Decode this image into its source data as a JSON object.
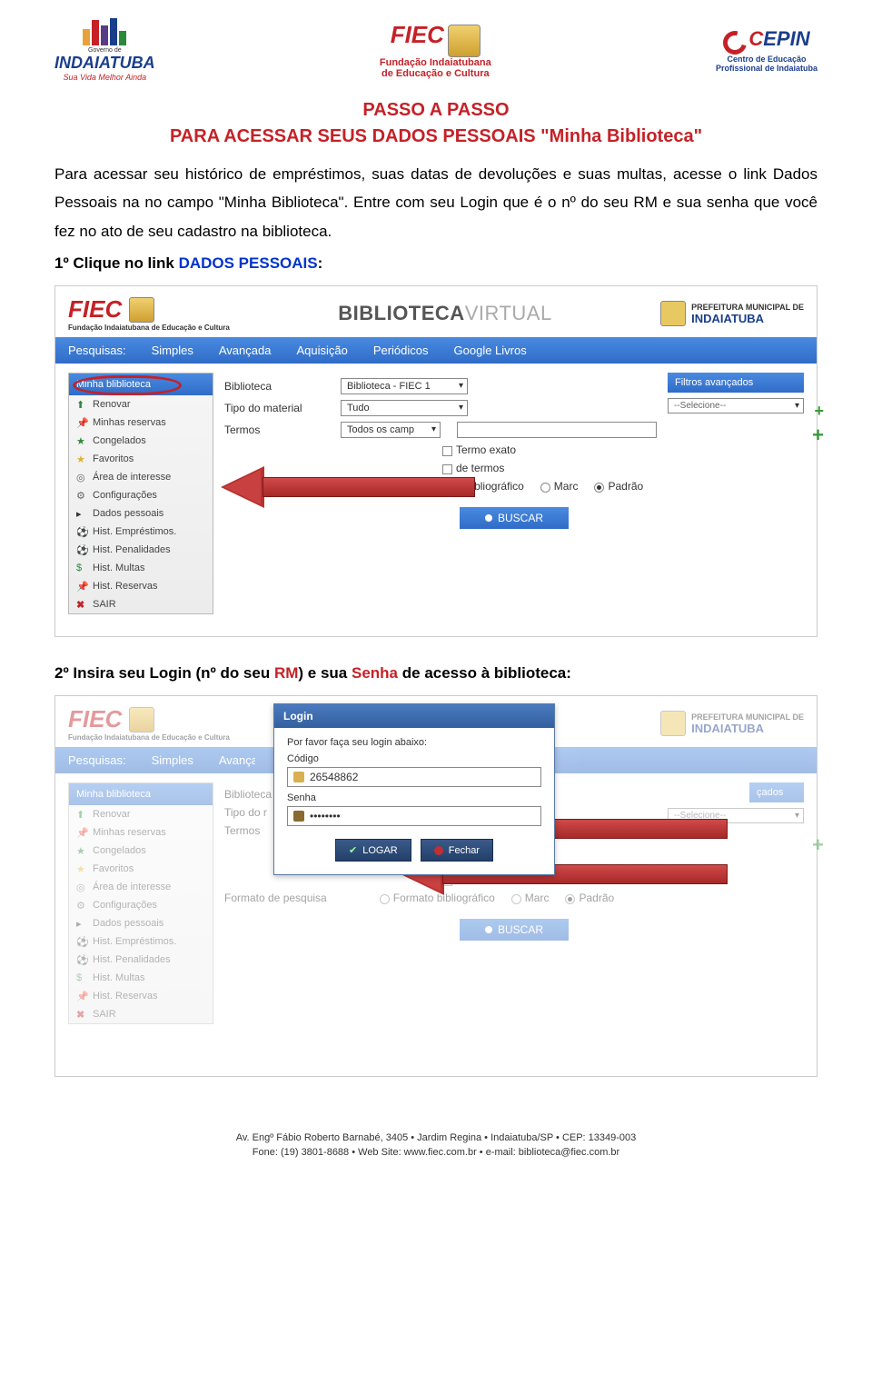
{
  "header": {
    "indaiatuba": {
      "name": "INDAIATUBA",
      "tagline": "Sua Vida Melhor Ainda",
      "gov": "Governo de"
    },
    "fiec": {
      "title": "FIEC",
      "sub1": "Fundação Indaiatubana",
      "sub2": "de Educação e Cultura"
    },
    "cepin": {
      "title_c": "C",
      "title_rest": "EPIN",
      "sub1": "Centro de Educação",
      "sub2": "Profissional de Indaiatuba"
    }
  },
  "doc": {
    "title1": "PASSO A PASSO",
    "title2": "PARA ACESSAR SEUS DADOS PESSOAIS \"Minha Biblioteca\"",
    "paragraph": "Para acessar seu histórico de empréstimos, suas datas de devoluções e suas multas, acesse o link Dados Pessoais na no campo \"Minha Biblioteca\". Entre com seu Login que é o nº do seu RM e sua senha que você fez no ato de seu cadastro na biblioteca.",
    "step1_prefix": " 1º Clique no link ",
    "step1_link": "DADOS PESSOAIS",
    "step1_suffix": ":",
    "step2_prefix": "2º Insira seu Login (nº do seu ",
    "step2_rm": "RM",
    "step2_mid": ") e sua ",
    "step2_senha": "Senha",
    "step2_suffix": " de acesso à biblioteca:"
  },
  "ss": {
    "fiec_title": "FIEC",
    "fiec_sub": "Fundação Indaiatubana de Educação e Cultura",
    "bv_b": "BIBLIOTECA",
    "bv_v": "VIRTUAL",
    "pref_line1": "PREFEITURA MUNICIPAL DE",
    "pref_line2": "INDAIATUBA",
    "nav": {
      "label": "Pesquisas:",
      "items": [
        "Simples",
        "Avançada",
        "Aquisição",
        "Periódicos",
        "Google Livros"
      ]
    },
    "sidebar": {
      "head": "Minha bliblioteca",
      "items": [
        "Renovar",
        "Minhas reservas",
        "Congelados",
        "Favoritos",
        "Área de interesse",
        "Configurações",
        "Dados pessoais",
        "Hist. Empréstimos.",
        "Hist. Penalidades",
        "Hist. Multas",
        "Hist. Reservas",
        "SAIR"
      ]
    },
    "form": {
      "row1_label": "Biblioteca",
      "row1_value": "Biblioteca - FIEC 1",
      "row2_label": "Tipo do material",
      "row2_value": "Tudo",
      "row3_label": "Termos",
      "row3_value": "Todos os camp",
      "chk1": "Termo exato",
      "chk2_suffix": "de termos",
      "pesquisa_label": "ato de pesquisa",
      "formato_label": "Formato bibliográfico",
      "marc": "Marc",
      "padrao": "Padrão",
      "buscar": "BUSCAR"
    },
    "filters": {
      "head": "Filtros avançados",
      "sel": "--Selecione--"
    },
    "form2": {
      "cruzamento": "Cruzamento de termos",
      "formato_pesquisa": "Formato de pesquisa"
    }
  },
  "login": {
    "head": "Login",
    "prompt": "Por favor faça seu login abaixo:",
    "codigo_label": "Código",
    "codigo_value": "26548862",
    "senha_label": "Senha",
    "senha_value": "••••••••",
    "btn_logar": "LOGAR",
    "btn_fechar": "Fechar"
  },
  "footer": {
    "line1": "Av. Engº Fábio Roberto Barnabé, 3405 • Jardim Regina • Indaiatuba/SP • CEP: 13349-003",
    "line2": "Fone: (19) 3801-8688 • Web Site: www.fiec.com.br • e-mail: biblioteca@fiec.com.br"
  }
}
